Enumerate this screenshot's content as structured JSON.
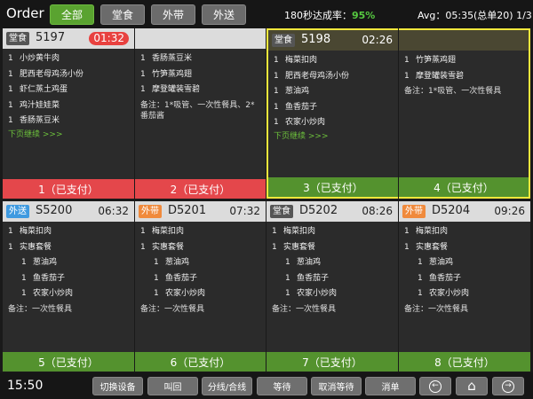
{
  "header": {
    "title": "Order",
    "tabs": [
      {
        "label": "全部",
        "active": true
      },
      {
        "label": "堂食",
        "active": false
      },
      {
        "label": "外带",
        "active": false
      },
      {
        "label": "外送",
        "active": false
      }
    ],
    "rate_label": "180秒达成率：",
    "rate_value": "95%",
    "avg": "Avg：05:35",
    "summary": "(总单20) 1/3"
  },
  "cards": [
    {
      "type": "堂食",
      "type_class": "dine",
      "order": "5197",
      "timer": "01:32",
      "late": true,
      "items": [
        {
          "q": "1",
          "n": "小炒黄牛肉"
        },
        {
          "q": "1",
          "n": "肥西老母鸡汤小份"
        },
        {
          "q": "1",
          "n": "虾仁蒸土鸡蛋"
        },
        {
          "q": "1",
          "n": "鸡汁娃娃菜"
        },
        {
          "q": "1",
          "n": "香肠蒸豆米"
        }
      ],
      "note": "",
      "more": "下页继续 >>>",
      "pay": "1（已支付）",
      "pay_color": "red"
    },
    {
      "type": "",
      "type_class": "",
      "order": "",
      "timer": "",
      "late": false,
      "items": [
        {
          "q": "1",
          "n": "香肠蒸豆米"
        },
        {
          "q": "1",
          "n": "竹笋蒸鸡翅"
        },
        {
          "q": "1",
          "n": "摩登罐装雪碧"
        }
      ],
      "note": "备注：1*吸管、一次性餐具、2*番茄酱",
      "more": "",
      "pay": "2（已支付）",
      "pay_color": "red"
    },
    {
      "type": "堂食",
      "type_class": "dine",
      "order": "5198",
      "timer": "02:26",
      "late": false,
      "items": [
        {
          "q": "1",
          "n": "梅菜扣肉"
        },
        {
          "q": "1",
          "n": "肥西老母鸡汤小份"
        },
        {
          "q": "1",
          "n": "葱油鸡"
        },
        {
          "q": "1",
          "n": "鱼香茄子"
        },
        {
          "q": "1",
          "n": "农家小炒肉"
        }
      ],
      "note": "",
      "more": "下页继续 >>>",
      "pay": "3（已支付）",
      "pay_color": "green"
    },
    {
      "type": "",
      "type_class": "",
      "order": "",
      "timer": "",
      "late": false,
      "items": [
        {
          "q": "1",
          "n": "竹笋蒸鸡翅"
        },
        {
          "q": "1",
          "n": "摩登罐装雪碧"
        }
      ],
      "note": "备注：1*吸管、一次性餐具",
      "more": "",
      "pay": "4（已支付）",
      "pay_color": "green"
    },
    {
      "type": "外送",
      "type_class": "deliver",
      "order": "S5200",
      "timer": "06:32",
      "late": false,
      "items": [
        {
          "q": "1",
          "n": "梅菜扣肉"
        },
        {
          "q": "1",
          "n": "实惠套餐"
        },
        {
          "q": "1",
          "n": "葱油鸡",
          "sub": true
        },
        {
          "q": "1",
          "n": "鱼香茄子",
          "sub": true
        },
        {
          "q": "1",
          "n": "农家小炒肉",
          "sub": true
        }
      ],
      "note": "备注：一次性餐具",
      "more": "",
      "pay": "5（已支付）",
      "pay_color": "green"
    },
    {
      "type": "外带",
      "type_class": "out",
      "order": "D5201",
      "timer": "07:32",
      "late": false,
      "items": [
        {
          "q": "1",
          "n": "梅菜扣肉"
        },
        {
          "q": "1",
          "n": "实惠套餐"
        },
        {
          "q": "1",
          "n": "葱油鸡",
          "sub": true
        },
        {
          "q": "1",
          "n": "鱼香茄子",
          "sub": true
        },
        {
          "q": "1",
          "n": "农家小炒肉",
          "sub": true
        }
      ],
      "note": "备注：一次性餐具",
      "more": "",
      "pay": "6（已支付）",
      "pay_color": "green"
    },
    {
      "type": "堂食",
      "type_class": "dine",
      "order": "D5202",
      "timer": "08:26",
      "late": false,
      "items": [
        {
          "q": "1",
          "n": "梅菜扣肉"
        },
        {
          "q": "1",
          "n": "实惠套餐"
        },
        {
          "q": "1",
          "n": "葱油鸡",
          "sub": true
        },
        {
          "q": "1",
          "n": "鱼香茄子",
          "sub": true
        },
        {
          "q": "1",
          "n": "农家小炒肉",
          "sub": true
        }
      ],
      "note": "备注：一次性餐具",
      "more": "",
      "pay": "7（已支付）",
      "pay_color": "green"
    },
    {
      "type": "外带",
      "type_class": "out",
      "order": "D5204",
      "timer": "09:26",
      "late": false,
      "items": [
        {
          "q": "1",
          "n": "梅菜扣肉"
        },
        {
          "q": "1",
          "n": "实惠套餐"
        },
        {
          "q": "1",
          "n": "葱油鸡",
          "sub": true
        },
        {
          "q": "1",
          "n": "鱼香茄子",
          "sub": true
        },
        {
          "q": "1",
          "n": "农家小炒肉",
          "sub": true
        }
      ],
      "note": "备注：一次性餐具",
      "more": "",
      "pay": "8（已支付）",
      "pay_color": "green"
    }
  ],
  "footer": {
    "clock": "15:50",
    "buttons": [
      "切换设备",
      "叫回",
      "分线/合线",
      "等待",
      "取消等待",
      "消单"
    ],
    "nav": [
      {
        "icon": "arrow-left-icon",
        "glyph": "←"
      },
      {
        "icon": "home-icon",
        "glyph": "⌂"
      },
      {
        "icon": "arrow-right-icon",
        "glyph": "→"
      }
    ]
  }
}
